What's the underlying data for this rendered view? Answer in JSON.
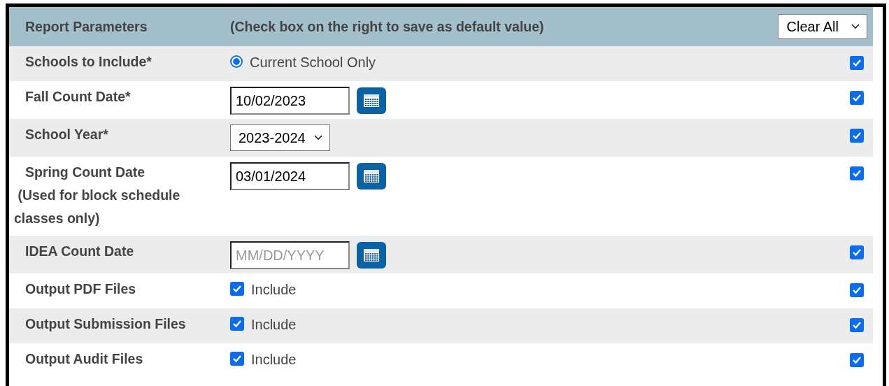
{
  "header": {
    "title": "Report Parameters",
    "hint": "(Check box on the right to save as default value)",
    "menu": {
      "value": "Clear All"
    }
  },
  "rows": [
    {
      "label": "Schools to Include*",
      "kind": "radio",
      "option": "Current School Only",
      "selected": true,
      "save_default": true
    },
    {
      "label": "Fall Count Date*",
      "kind": "date",
      "value": "10/02/2023",
      "save_default": true
    },
    {
      "label": "School Year*",
      "kind": "select",
      "value": "2023-2024",
      "save_default": true
    },
    {
      "label": "Spring Count Date\n (Used for block schedule classes only)",
      "kind": "date",
      "value": "03/01/2024",
      "save_default": true
    },
    {
      "label": "IDEA Count Date",
      "kind": "date",
      "placeholder": "MM/DD/YYYY",
      "save_default": true
    },
    {
      "label": "Output PDF Files",
      "kind": "checkbox",
      "option": "Include",
      "checked": true,
      "save_default": true
    },
    {
      "label": "Output Submission Files",
      "kind": "checkbox",
      "option": "Include",
      "checked": true,
      "save_default": true
    },
    {
      "label": "Output Audit Files",
      "kind": "checkbox",
      "option": "Include",
      "checked": true,
      "save_default": true
    }
  ]
}
